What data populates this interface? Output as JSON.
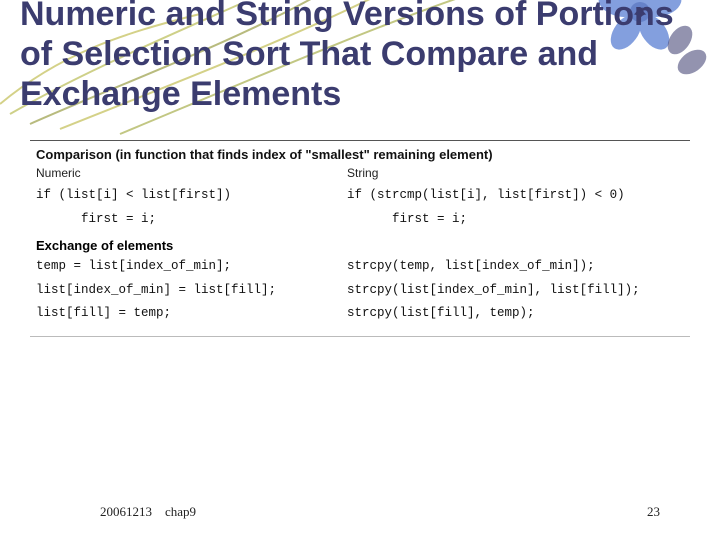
{
  "title": "Numeric and String Versions of Portions of Selection Sort That Compare and Exchange Elements",
  "table": {
    "section1_title": "Comparison (in function that finds index of \"smallest\" remaining element)",
    "col_left_hdr": "Numeric",
    "col_right_hdr": "String",
    "cmp_left_1": "if (list[i] < list[first])",
    "cmp_right_1": "if (strcmp(list[i], list[first]) < 0)",
    "cmp_left_2": "      first = i;",
    "cmp_right_2": "      first = i;",
    "section2_title": "Exchange of elements",
    "ex_left_1": "temp = list[index_of_min];",
    "ex_right_1": "strcpy(temp, list[index_of_min]);",
    "ex_left_2": "list[index_of_min] = list[fill];",
    "ex_right_2": "strcpy(list[index_of_min], list[fill]);",
    "ex_left_3": "list[fill] = temp;",
    "ex_right_3": "strcpy(list[fill], temp);"
  },
  "footer": {
    "date": "20061213",
    "chapter": "chap9",
    "page": "23"
  },
  "decor": {
    "straw_color_a": "#b8b43a",
    "straw_color_b": "#8a8f2a",
    "flower_ink": "#3b3c6f",
    "flower_blue": "#6e8fd9"
  }
}
